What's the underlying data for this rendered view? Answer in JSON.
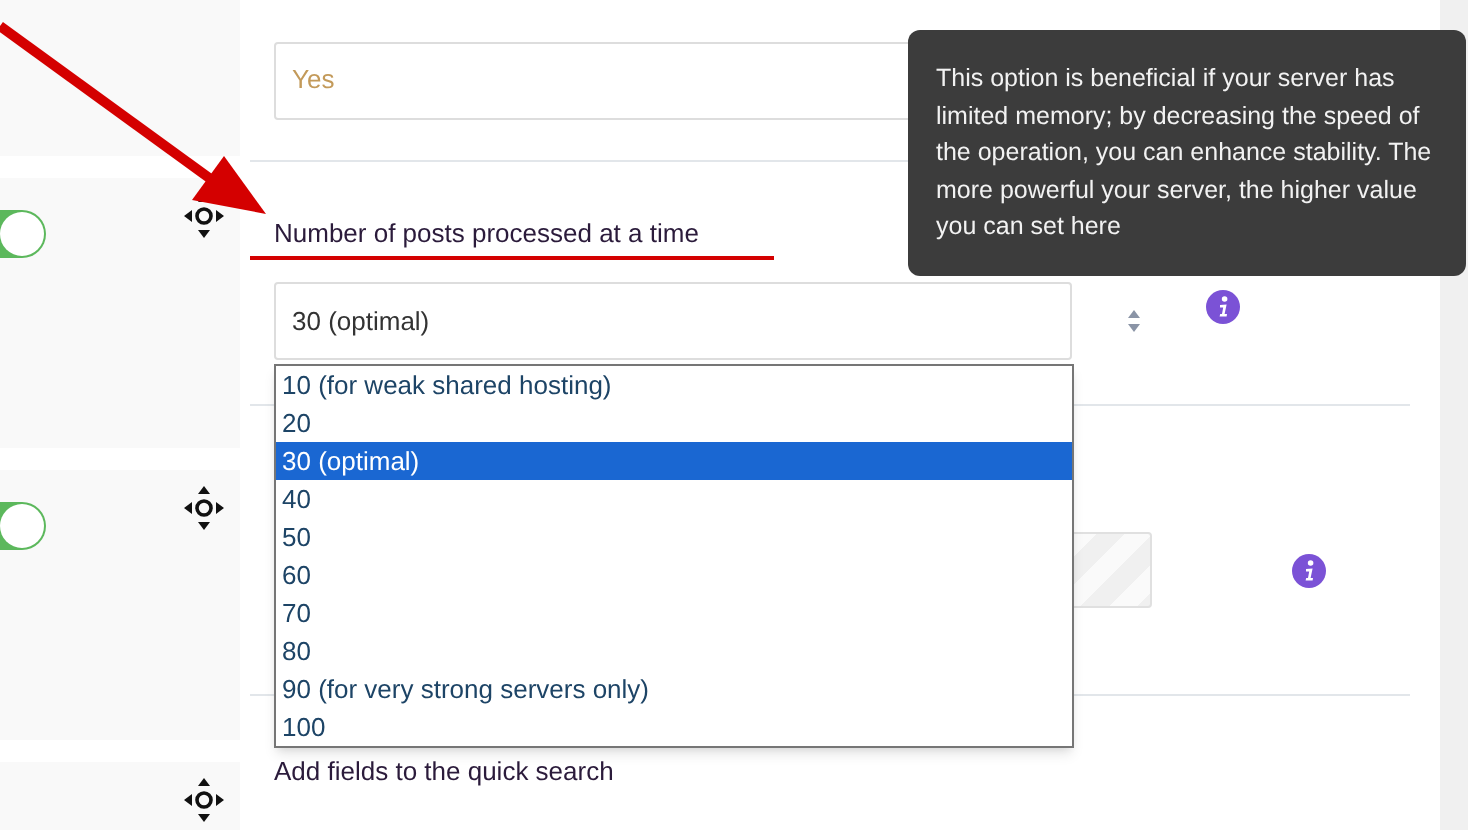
{
  "side_panels": [
    {
      "kind": "plain"
    },
    {
      "kind": "toggle",
      "toggle_on": true
    },
    {
      "kind": "toggle",
      "toggle_on": true
    },
    {
      "kind": "plain"
    }
  ],
  "sections": [
    {
      "kind": "text",
      "value": "Yes"
    },
    {
      "kind": "select",
      "label": "Number of posts processed at a time",
      "value": "30 (optimal)",
      "options": [
        {
          "label": "10 (for weak shared hosting)",
          "selected": false
        },
        {
          "label": "20",
          "selected": false
        },
        {
          "label": "30 (optimal)",
          "selected": true
        },
        {
          "label": "40",
          "selected": false
        },
        {
          "label": "50",
          "selected": false
        },
        {
          "label": "60",
          "selected": false
        },
        {
          "label": "70",
          "selected": false
        },
        {
          "label": "80",
          "selected": false
        },
        {
          "label": "90 (for very strong servers only)",
          "selected": false
        },
        {
          "label": "100",
          "selected": false
        }
      ]
    },
    {
      "kind": "text",
      "disabled": true
    },
    {
      "kind": "heading",
      "label": "Add fields to the quick search"
    }
  ],
  "tooltip": {
    "text": "This option is beneficial if your server has limited memory; by decreasing the speed of the operation, you can enhance stability. The more powerful your server, the higher value you can set here"
  }
}
